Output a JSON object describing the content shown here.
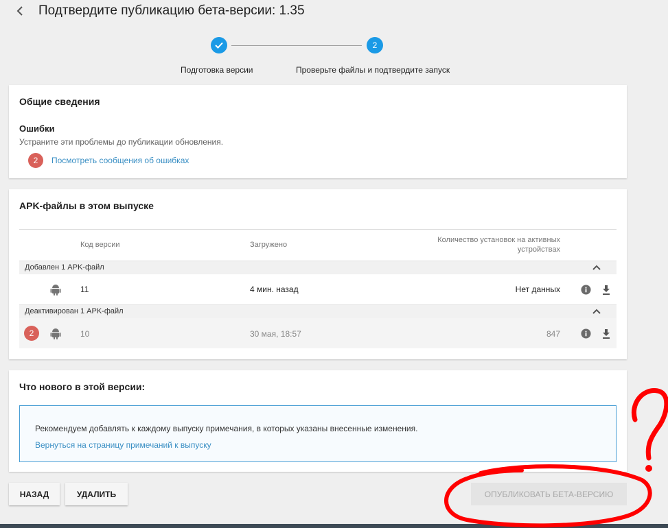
{
  "header": {
    "back_icon": "chevron-left-icon",
    "title": "Подтвердите публикацию бета-версии: 1.35"
  },
  "stepper": {
    "steps": [
      {
        "label": "Подготовка версии",
        "state": "done",
        "icon": "check-icon"
      },
      {
        "label": "Проверьте файлы и подтвердите запуск",
        "state": "current",
        "number": "2"
      }
    ],
    "accent": "#1a9ae6"
  },
  "general": {
    "title": "Общие сведения",
    "errors_heading": "Ошибки",
    "errors_desc": "Устраните эти проблемы до публикации обновления.",
    "error_count": "2",
    "errors_link": "Посмотреть сообщения об ошибках"
  },
  "apk": {
    "title": "APK-файлы в этом выпуске",
    "columns": {
      "version_code": "Код версии",
      "uploaded": "Загружено",
      "installs_line1": "Количество установок на активных",
      "installs_line2": "устройствах"
    },
    "groups": [
      {
        "label": "Добавлен 1 APK-файл",
        "rows": [
          {
            "version_code": "11",
            "uploaded": "4 мин. назад",
            "installs": "Нет данных"
          }
        ]
      },
      {
        "label": "Деактивирован 1 APK-файл",
        "rows": [
          {
            "error_count": "2",
            "version_code": "10",
            "uploaded": "30 мая, 18:57",
            "installs": "847"
          }
        ]
      }
    ]
  },
  "whats_new": {
    "title": "Что нового в этой версии:",
    "notes_text": "Рекомендуем добавлять к каждому выпуску примечания, в которых указаны внесенные изменения.",
    "notes_link": "Вернуться на страницу примечаний к выпуску"
  },
  "buttons": {
    "back": "НАЗАД",
    "delete": "УДАЛИТЬ",
    "publish": "ОПУБЛИКОВАТЬ БЕТА-ВЕРСИЮ"
  },
  "colors": {
    "error_badge": "#d9615a",
    "link": "#3a8fc4",
    "annotation": "#ff0000"
  }
}
